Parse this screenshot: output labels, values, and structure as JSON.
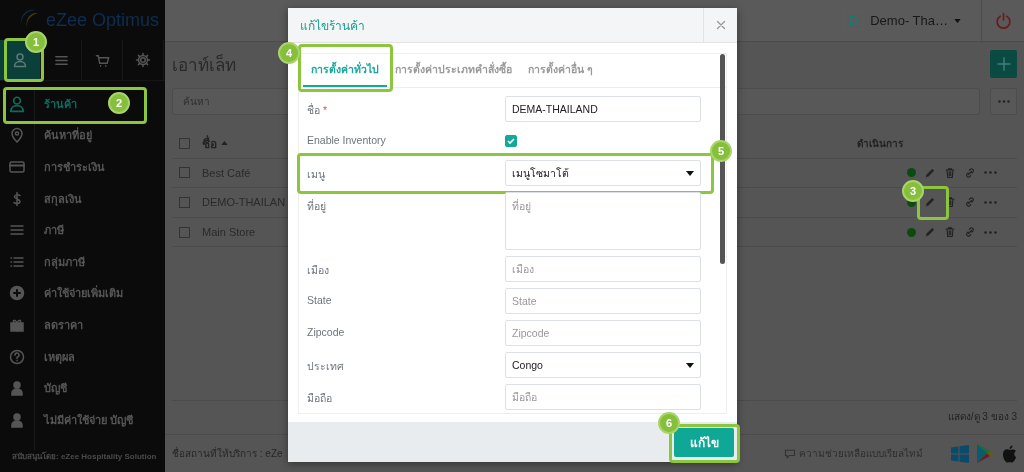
{
  "sidebar": {
    "logo": "eZee Optimus",
    "top_tabs": [
      {
        "selected": true,
        "step": "1"
      },
      {
        "selected": false
      },
      {
        "selected": false
      },
      {
        "selected": false
      }
    ],
    "items": [
      {
        "label": "ร้านค้า",
        "selected": true,
        "step": "2"
      },
      {
        "label": "ค้นหาที่อยู่",
        "selected": false
      },
      {
        "label": "การชำระเงิน",
        "selected": false
      },
      {
        "label": "สกุลเงิน",
        "selected": false
      },
      {
        "label": "ภาษี",
        "selected": false
      },
      {
        "label": "กลุ่มภาษี",
        "selected": false
      },
      {
        "label": "ค่าใช้จ่ายเพิ่มเติม",
        "selected": false
      },
      {
        "label": "ลดราคา",
        "selected": false
      },
      {
        "label": "เหตุผล",
        "selected": false
      },
      {
        "label": "บัญชี",
        "selected": false
      },
      {
        "label": "ไม่มีค่าใช้จ่าย บัญชี",
        "selected": false
      }
    ],
    "footer": "สนับสนุนโดย: eZee Hospitality Solution"
  },
  "header": {
    "store_initial": "D",
    "store_name": "Demo- Tha…"
  },
  "page": {
    "title": "เอาท์เล็ท",
    "search": {
      "placeholder": "ค้นหา"
    },
    "table": {
      "select_all": {
        "checked": false
      },
      "columns": [
        {
          "label": "ชื่อ",
          "sort_ascending": true
        },
        {
          "label": "ดำเนินการ"
        }
      ],
      "rows": [
        {
          "name": "Best Café",
          "checked": false,
          "active": true
        },
        {
          "name": "DEMO-THAILAN",
          "checked": false,
          "active": true,
          "edit_step": "3"
        },
        {
          "name": "Main Store",
          "checked": false,
          "active": true
        }
      ]
    },
    "summary": "แสดง/ดู 3 ของ 3"
  },
  "footer": {
    "provider": "ชื่อสถานที่ให้บริการ : eZe",
    "help": "ความช่วยเหลือแบบเรียลไทม์"
  },
  "modal": {
    "title": "แก้ไขร้านค้า",
    "tabs": [
      {
        "label": "การตั้งค่าทั่วไป",
        "selected": true,
        "step": "4"
      },
      {
        "label": "การตั้งค่าประเภทคำสั่งซื้อ",
        "selected": false
      },
      {
        "label": "การตั้งค่าอื่น ๆ",
        "selected": false
      }
    ],
    "fields": [
      {
        "kind": "text",
        "label": "ชื่อ",
        "required_mark": "*",
        "value": "DEMA-THAILAND"
      },
      {
        "kind": "checkbox",
        "label": "Enable Inventory",
        "checked": true
      },
      {
        "kind": "select",
        "label": "เมนู",
        "value": "เมนูโซมาโต้",
        "step": "5"
      },
      {
        "kind": "textarea",
        "label": "ที่อยู่",
        "placeholder": "ที่อยู่"
      },
      {
        "kind": "text",
        "label": "เมือง",
        "placeholder": "เมือง"
      },
      {
        "kind": "text",
        "label": "State",
        "placeholder": "State"
      },
      {
        "kind": "text",
        "label": "Zipcode",
        "placeholder": "Zipcode"
      },
      {
        "kind": "select",
        "label": "ประเทศ",
        "value": "Congo"
      },
      {
        "kind": "text",
        "label": "มือถือ",
        "placeholder": "มือถือ"
      }
    ],
    "save": {
      "label": "แก้ไข",
      "step": "6"
    }
  }
}
